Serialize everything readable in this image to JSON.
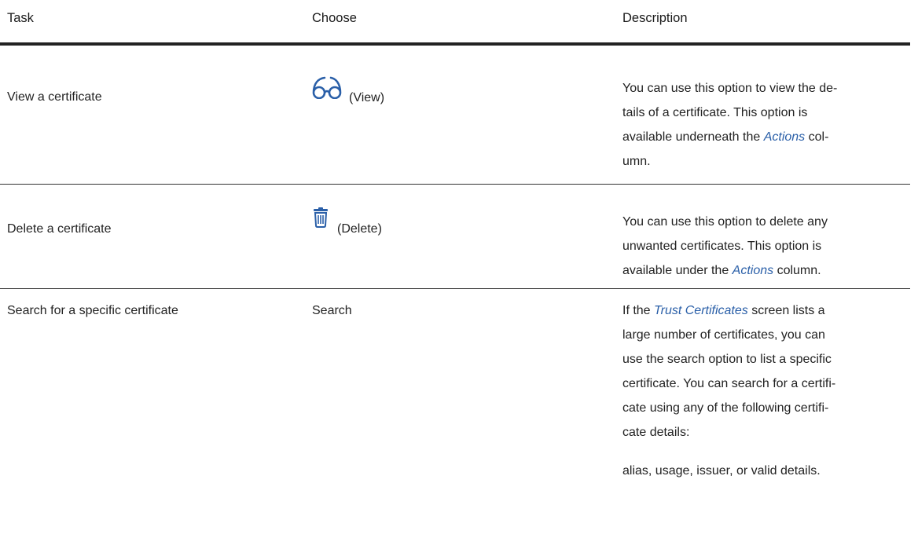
{
  "header": {
    "task": "Task",
    "choose": "Choose",
    "description": "Description"
  },
  "rows": [
    {
      "task": "View a certificate",
      "choose_icon": "glasses-icon",
      "choose_label": "(View)",
      "desc_parts": [
        "You can use this option to view the de-",
        "tails of a certificate. This option is",
        "available underneath the ",
        "Actions",
        " col-",
        "umn."
      ]
    },
    {
      "task": "Delete a certificate",
      "choose_icon": "trash-icon",
      "choose_label": "(Delete)",
      "desc_parts": [
        "You can use this option to delete any",
        "unwanted certificates. This option is",
        "available under the ",
        "Actions",
        " column."
      ]
    },
    {
      "task": "Search for a specific certificate",
      "choose_label": "Search",
      "desc_parts": [
        "If the ",
        "Trust Certificates",
        " screen lists a",
        "large number of certificates, you can",
        "use the search option to list a specific",
        "certificate. You can search for a certifi-",
        "cate using any of the following certifi-",
        "cate details:"
      ],
      "desc_p2": "alias, usage, issuer, or valid details."
    }
  ],
  "colors": {
    "icon": "#2a5fa8",
    "link": "#2a5fa8",
    "rule": "#222222"
  }
}
